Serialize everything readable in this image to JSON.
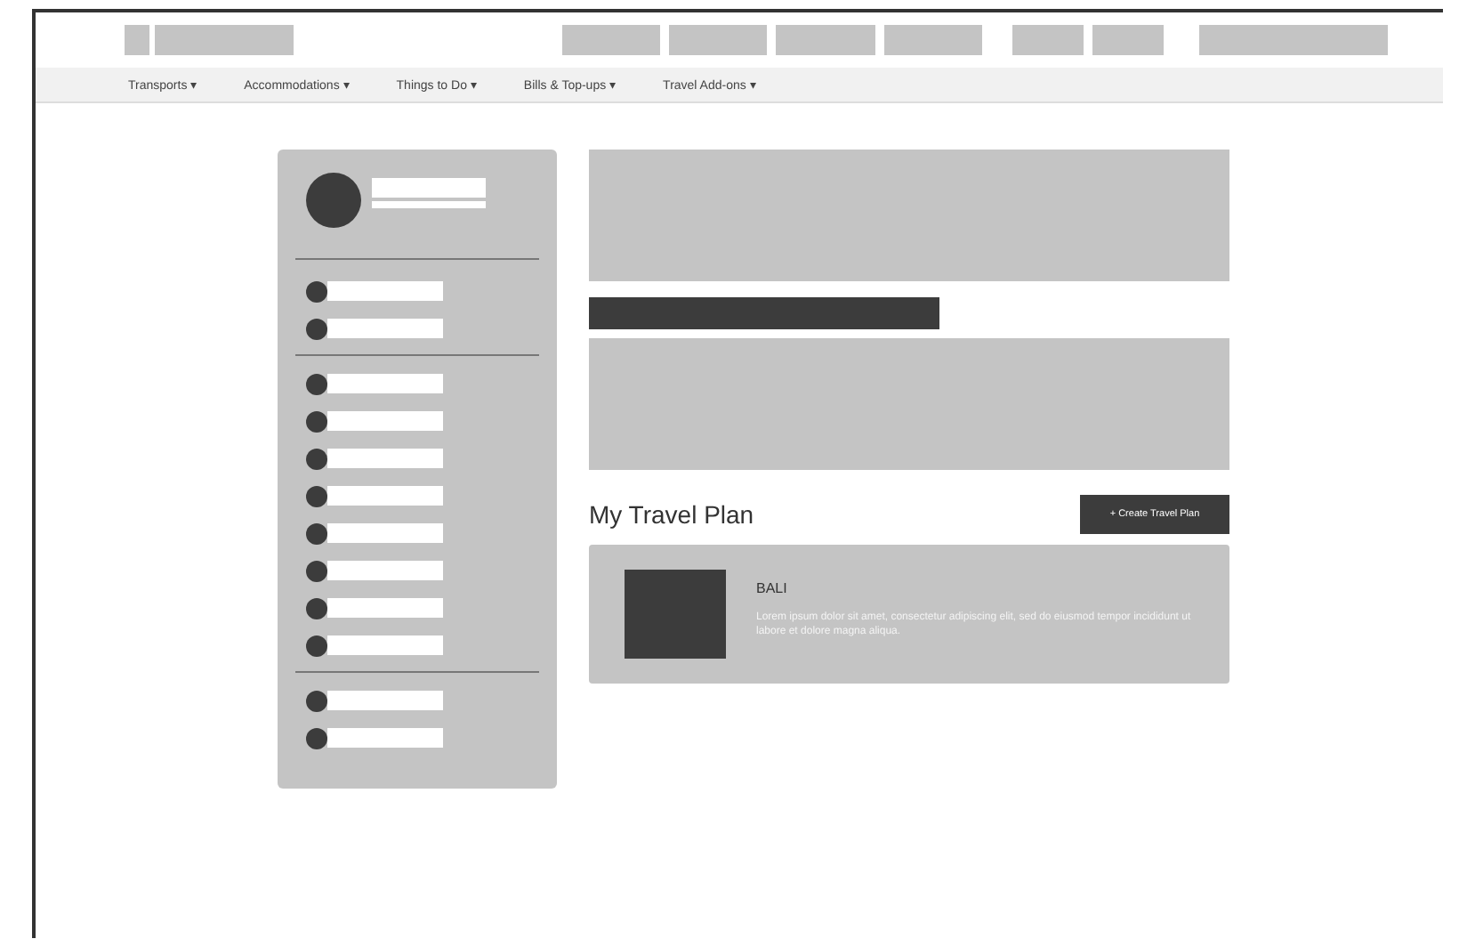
{
  "nav": [
    {
      "label": "Transports",
      "caret": "▾"
    },
    {
      "label": "Accommodations",
      "caret": "▾"
    },
    {
      "label": "Things to Do",
      "caret": "▾"
    },
    {
      "label": "Bills & Top-ups",
      "caret": "▾"
    },
    {
      "label": "Travel Add-ons",
      "caret": "▾"
    }
  ],
  "travel_plan": {
    "heading": "My Travel Plan",
    "create_button": "+ Create Travel Plan",
    "plans": [
      {
        "title": "BALI",
        "description": "Lorem ipsum dolor sit amet, consectetur adipiscing elit, sed do eiusmod tempor incididunt ut labore et dolore magna aliqua."
      }
    ]
  }
}
